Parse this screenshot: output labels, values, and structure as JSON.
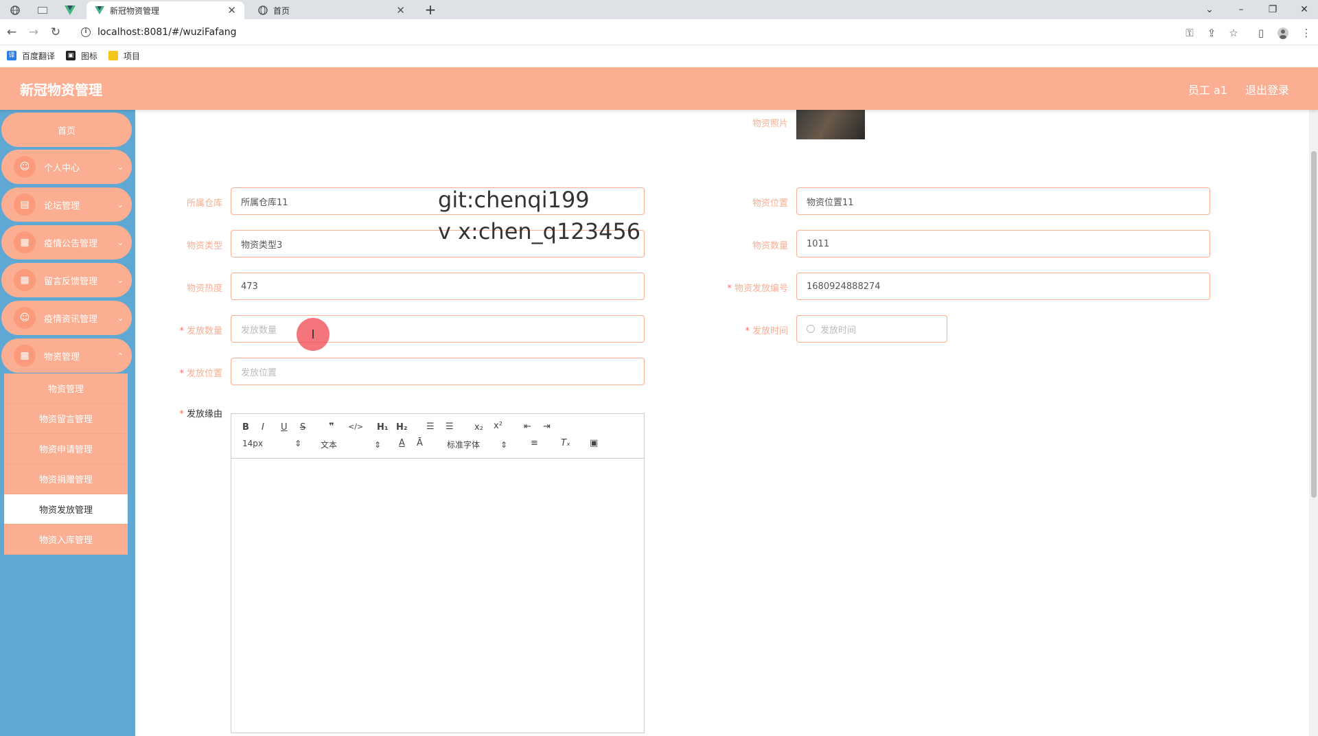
{
  "browser": {
    "tabs": [
      {
        "title": "新冠物资管理",
        "active": true
      },
      {
        "title": "首页",
        "active": false
      }
    ],
    "url": "localhost:8081/#/wuziFafang",
    "bookmarks": [
      "百度翻译",
      "图标",
      "项目"
    ]
  },
  "header": {
    "title": "新冠物资管理",
    "user": "员工 a1",
    "logout": "退出登录"
  },
  "sidebar": {
    "home": "首页",
    "menus": [
      "个人中心",
      "论坛管理",
      "疫情公告管理",
      "留言反馈管理",
      "疫情资讯管理",
      "物资管理"
    ],
    "submenu": [
      "物资管理",
      "物资留言管理",
      "物资申请管理",
      "物资捐赠管理",
      "物资发放管理",
      "物资入库管理"
    ],
    "active_submenu": "物资发放管理"
  },
  "form": {
    "photo_label": "物资照片",
    "warehouse_label": "所属仓库",
    "warehouse_value": "所属仓库11",
    "location_label": "物资位置",
    "location_value": "物资位置11",
    "type_label": "物资类型",
    "type_value": "物资类型3",
    "quantity_label": "物资数量",
    "quantity_value": "1011",
    "heat_label": "物资热度",
    "heat_value": "473",
    "code_label": "物资发放编号",
    "code_value": "1680924888274",
    "issue_qty_label": "发放数量",
    "issue_qty_placeholder": "发放数量",
    "issue_time_label": "发放时间",
    "issue_time_placeholder": "发放时间",
    "issue_place_label": "发放位置",
    "issue_place_placeholder": "发放位置",
    "reason_label": "发放缘由"
  },
  "editor": {
    "font_size": "14px",
    "header_select": "文本",
    "font_select": "标准字体"
  },
  "watermark": {
    "line1": "git:chenqi199",
    "line2": "v x:chen_q123456"
  }
}
